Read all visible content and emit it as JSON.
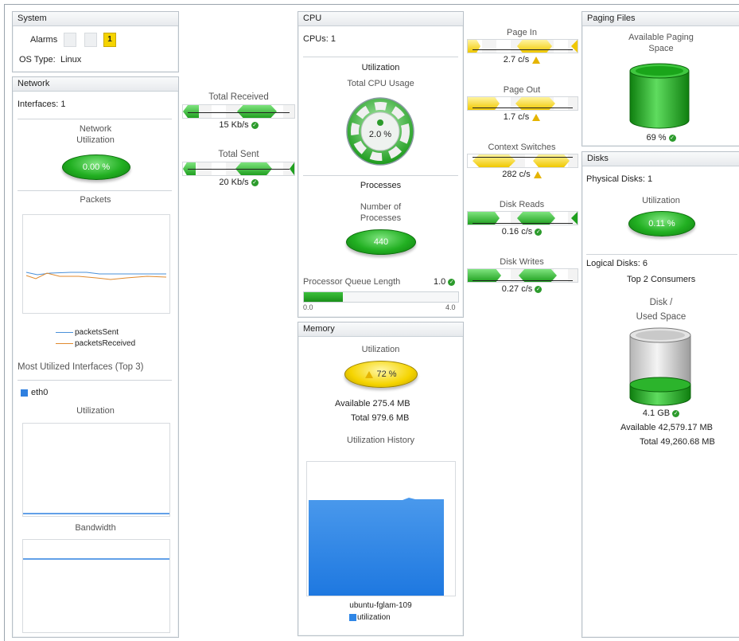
{
  "system": {
    "title": "System",
    "alarms_label": "Alarms",
    "alarm_count": "1",
    "os_type_label": "OS Type:",
    "os_type_value": "Linux"
  },
  "network": {
    "title": "Network",
    "interfaces_label": "Interfaces:",
    "interfaces_value": "1",
    "utilization_label_1": "Network",
    "utilization_label_2": "Utilization",
    "utilization_value": "0.00 %",
    "packets_title": "Packets",
    "legend_sent": "packetsSent",
    "legend_received": "packetsReceived",
    "most_utilized_title": "Most Utilized Interfaces (Top 3)",
    "interface_name": "eth0",
    "interface_utilization_title": "Utilization",
    "bandwidth_title": "Bandwidth",
    "colors": {
      "sent": "#4a90d9",
      "received": "#e08a2e",
      "interface": "#2f80e0"
    }
  },
  "transfer": {
    "total_received_label": "Total Received",
    "total_received_value": "15 Kb/s",
    "total_sent_label": "Total Sent",
    "total_sent_value": "20 Kb/s"
  },
  "cpu": {
    "title": "CPU",
    "cpus_label": "CPUs:",
    "cpus_value": "1",
    "utilization_section": "Utilization",
    "total_cpu_usage_label": "Total CPU Usage",
    "total_cpu_usage_value": "2.0 %",
    "processes_section": "Processes",
    "number_of_processes_label_1": "Number of",
    "number_of_processes_label_2": "Processes",
    "number_of_processes_value": "440",
    "queue_length_label": "Processor Queue Length",
    "queue_length_value": "1.0",
    "queue_fraction": 0.25,
    "queue_min": "0.0",
    "queue_max": "4.0"
  },
  "memory": {
    "title": "Memory",
    "utilization_label": "Utilization",
    "utilization_value": "72 %",
    "available_label": "Available",
    "available_value": "275.4 MB",
    "total_label": "Total",
    "total_value": "979.6 MB",
    "history_title": "Utilization History",
    "host_name": "ubuntu-fglam-109",
    "legend_label": "utilization",
    "color": "#2f86e6"
  },
  "io": {
    "page_in_label": "Page In",
    "page_in_value": "2.7 c/s",
    "page_out_label": "Page Out",
    "page_out_value": "1.7 c/s",
    "context_switches_label": "Context Switches",
    "context_switches_value": "282 c/s",
    "disk_reads_label": "Disk Reads",
    "disk_reads_value": "0.16 c/s",
    "disk_writes_label": "Disk Writes",
    "disk_writes_value": "0.27 c/s"
  },
  "paging": {
    "title": "Paging Files",
    "available_label_1": "Available Paging",
    "available_label_2": "Space",
    "value": "69 %",
    "fill_fraction": 0.69
  },
  "disks": {
    "title": "Disks",
    "physical_label": "Physical Disks:",
    "physical_value": "1",
    "utilization_label": "Utilization",
    "utilization_value": "0.11 %",
    "logical_label": "Logical Disks:",
    "logical_value": "6",
    "top_consumers": "Top 2 Consumers",
    "disk_label": "Disk /",
    "used_space_label": "Used Space",
    "used_value": "4.1 GB",
    "used_fraction": 0.12,
    "available_label": "Available",
    "available_value": "42,579.17 MB",
    "total_label": "Total",
    "total_value": "49,260.68 MB"
  }
}
